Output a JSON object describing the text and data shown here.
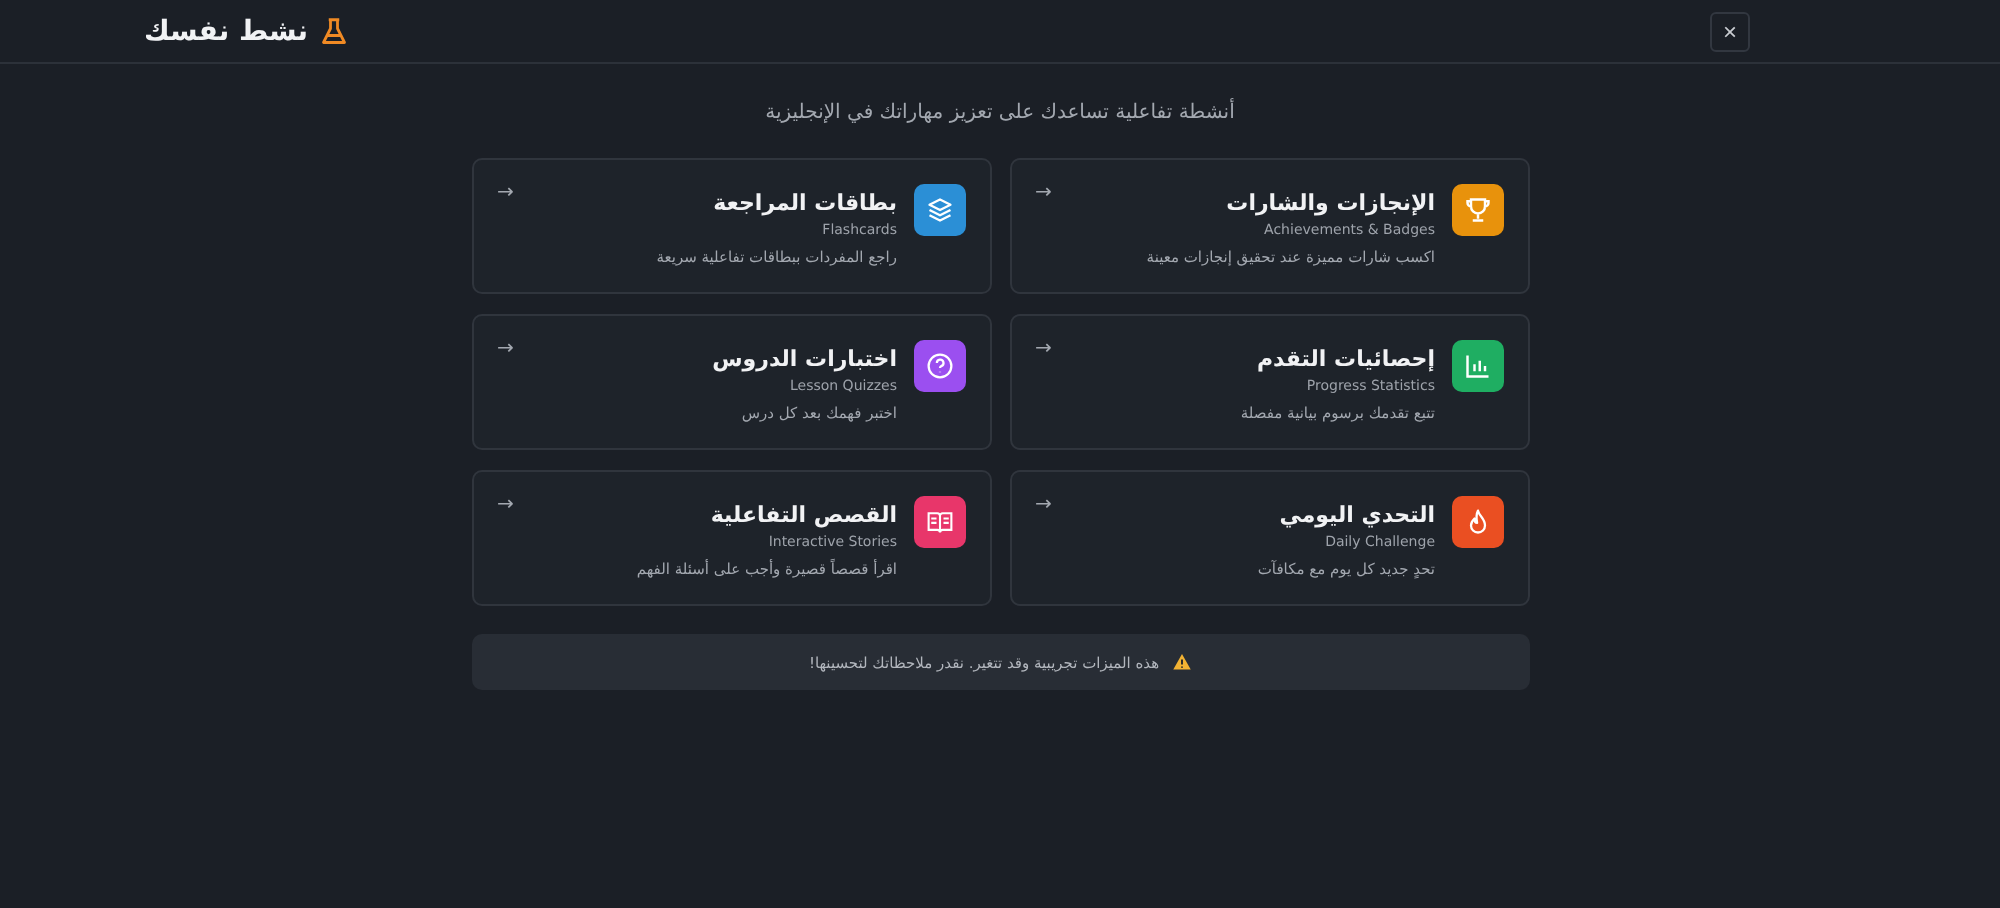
{
  "header": {
    "title": "نشط نفسك",
    "close": "×"
  },
  "subtitle": "أنشطة تفاعلية تساعدك على تعزيز مهاراتك في الإنجليزية",
  "cards": [
    {
      "kind": "trophy",
      "color": "#e8920c",
      "title": "الإنجازات والشارات",
      "subtitle": "Achievements & Badges",
      "description": "اكسب شارات مميزة عند تحقيق إنجازات معينة",
      "arrow": "→"
    },
    {
      "kind": "layers",
      "color": "#2b8fd6",
      "title": "بطاقات المراجعة",
      "subtitle": "Flashcards",
      "description": "راجع المفردات ببطاقات تفاعلية سريعة",
      "arrow": "→"
    },
    {
      "kind": "chart",
      "color": "#1fae62",
      "title": "إحصائيات التقدم",
      "subtitle": "Progress Statistics",
      "description": "تتبع تقدمك برسوم بيانية مفصلة",
      "arrow": "→"
    },
    {
      "kind": "question",
      "color": "#9b4ff0",
      "title": "اختبارات الدروس",
      "subtitle": "Lesson Quizzes",
      "description": "اختبر فهمك بعد كل درس",
      "arrow": "→"
    },
    {
      "kind": "flame",
      "color": "#ea4f22",
      "title": "التحدي اليومي",
      "subtitle": "Daily Challenge",
      "description": "تحدٍ جديد كل يوم مع مكافآت",
      "arrow": "→"
    },
    {
      "kind": "book",
      "color": "#e8366a",
      "title": "القصص التفاعلية",
      "subtitle": "Interactive Stories",
      "description": "اقرأ قصصاً قصيرة وأجب على أسئلة الفهم",
      "arrow": "→"
    }
  ],
  "notice": "هذه الميزات تجريبية وقد تتغير. نقدر ملاحظاتك لتحسينها!"
}
